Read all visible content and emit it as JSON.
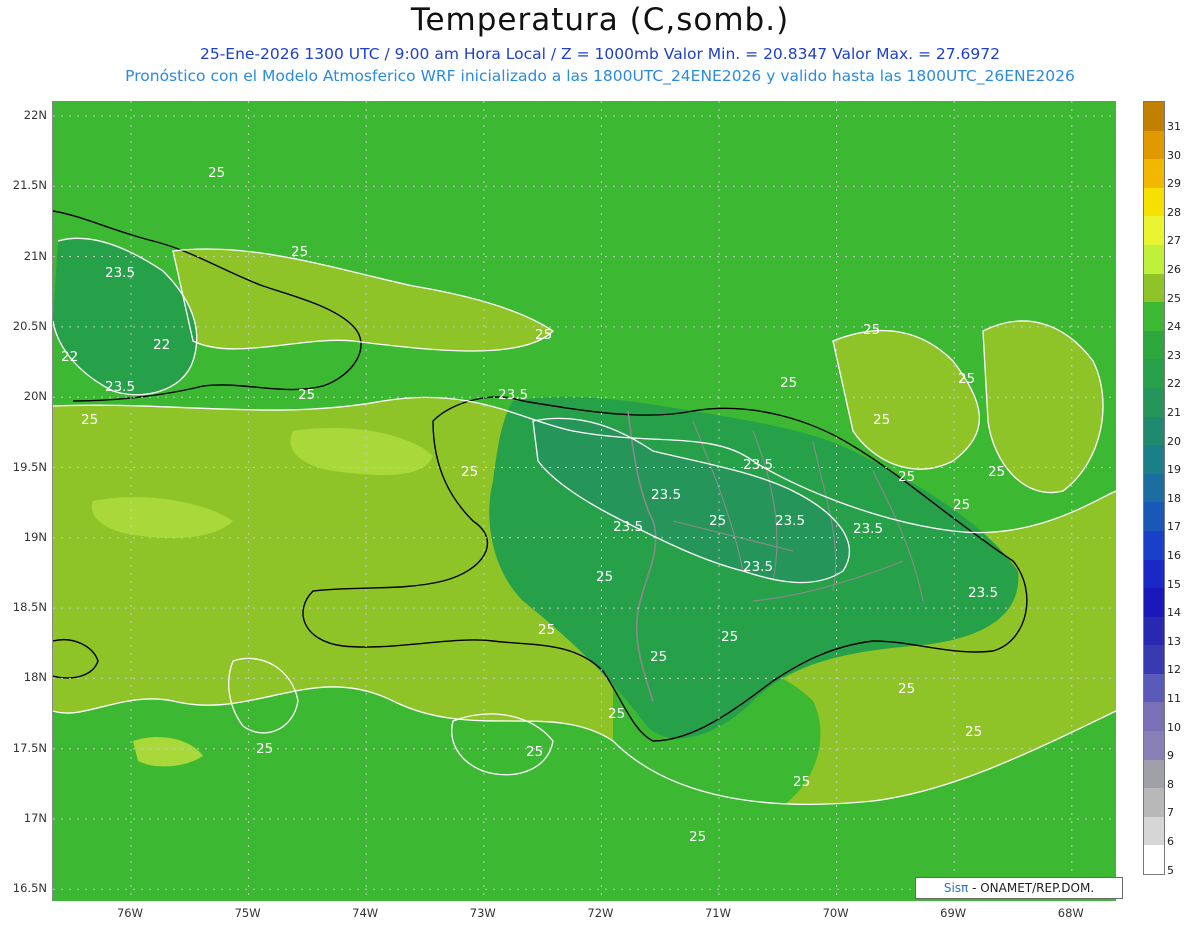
{
  "title": "Temperatura (C,somb.)",
  "subtitle_1": "25-Ene-2026  1300 UTC / 9:00 am Hora Local / Z = 1000mb   Valor Min. = 20.8347  Valor Max. = 27.6972",
  "subtitle_2": "Pronóstico con el Modelo Atmosferico WRF inicializado a las 1800UTC_24ENE2026 y valido hasta las  1800UTC_26ENE2026",
  "lat_labels": [
    "22N",
    "21.5N",
    "21N",
    "20.5N",
    "20N",
    "19.5N",
    "19N",
    "18.5N",
    "18N",
    "17.5N",
    "17N",
    "16.5N"
  ],
  "lon_labels": [
    "76W",
    "75W",
    "74W",
    "73W",
    "72W",
    "71W",
    "70W",
    "69W",
    "68W"
  ],
  "colorbar": {
    "labels": [
      "31",
      "30",
      "29",
      "28",
      "27",
      "26",
      "25",
      "24",
      "23",
      "22",
      "21",
      "20",
      "19",
      "18",
      "17",
      "16",
      "15",
      "14",
      "13",
      "12",
      "11",
      "10",
      "9",
      "8",
      "7",
      "6",
      "5"
    ],
    "colors": [
      "#c28000",
      "#e09a00",
      "#f2b800",
      "#f5e000",
      "#e8f530",
      "#bff03a",
      "#8fc428",
      "#3cb832",
      "#2ea83c",
      "#27a04a",
      "#25955a",
      "#1f8a70",
      "#1a7f88",
      "#1a6fa0",
      "#1a58b8",
      "#1a3fc8",
      "#1a28c8",
      "#1a18b8",
      "#2828b0",
      "#3a3ab0",
      "#5a5ab8",
      "#7a70b8",
      "#8a80b8",
      "#a0a0a8",
      "#b8b8b8",
      "#d6d6d6",
      "#ffffff"
    ]
  },
  "contour_labels": [
    "25",
    "23.5",
    "22"
  ],
  "credit": {
    "brand": "Sisπ",
    "text": " - ONAMET/REP.DOM."
  },
  "fill_colors": {
    "ocean": "#3cb832",
    "warm_band": "#8fc428",
    "warmest": "#a8d83a",
    "land_cool": "#27a04a",
    "land_coolest": "#25955a",
    "contour": "#ffffff",
    "coast": "#000000",
    "border": "#8a8a8a"
  }
}
